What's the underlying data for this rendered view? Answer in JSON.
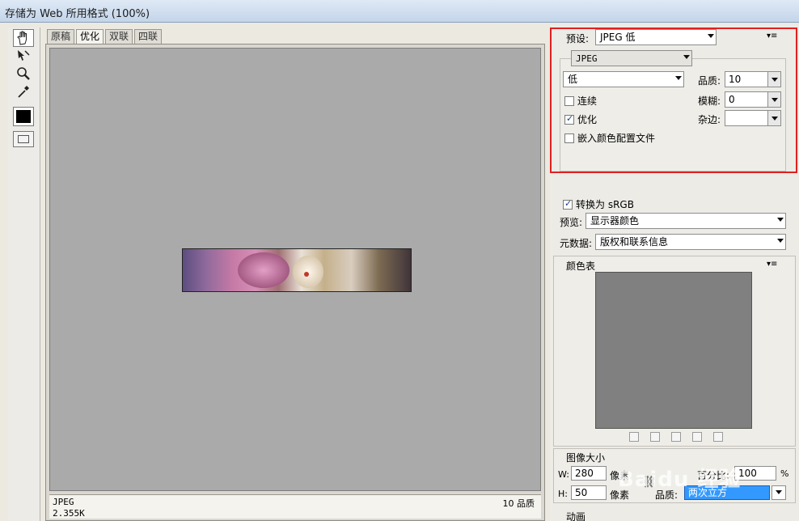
{
  "window": {
    "title": "存储为 Web 所用格式 (100%)"
  },
  "tools": [
    {
      "name": "hand-icon"
    },
    {
      "name": "slice-select-icon"
    },
    {
      "name": "zoom-icon"
    },
    {
      "name": "eyedropper-icon"
    }
  ],
  "tabs": [
    {
      "label": "原稿",
      "active": false
    },
    {
      "label": "优化",
      "active": true
    },
    {
      "label": "双联",
      "active": false
    },
    {
      "label": "四联",
      "active": false
    }
  ],
  "status": {
    "format": "JPEG",
    "size": "2.355K",
    "quality": "10 品质"
  },
  "settings": {
    "preset_label": "预设:",
    "preset_value": "JPEG 低",
    "format_value": "JPEG",
    "quality_level_value": "低",
    "quality_label": "品质:",
    "quality_value": "10",
    "progressive_label": "连续",
    "blur_label": "模糊:",
    "blur_value": "0",
    "optimized_label": "优化",
    "matte_label": "杂边:",
    "matte_value": "",
    "embed_profile_label": "嵌入颜色配置文件",
    "convert_srgb_label": "转换为 sRGB",
    "preview_label": "预览:",
    "preview_value": "显示器颜色",
    "metadata_label": "元数据:",
    "metadata_value": "版权和联系信息"
  },
  "checkboxes": {
    "progressive": false,
    "optimized": true,
    "embed_profile": false,
    "convert_srgb": true
  },
  "color_table": {
    "title": "颜色表"
  },
  "image_size": {
    "title": "图像大小",
    "w_label": "W:",
    "w_value": "280",
    "h_label": "H:",
    "h_value": "50",
    "unit": "像素",
    "percent_label": "百分比:",
    "percent_value": "100",
    "percent_unit": "%",
    "quality_label": "品质:",
    "quality_value": "两次立方"
  },
  "animation": {
    "title": "动画"
  },
  "watermark": "Baidu 经验",
  "colors": {
    "highlight_box": "#e02020",
    "canvas_bg": "#aaaaaa",
    "color_table_bg": "#808080"
  }
}
